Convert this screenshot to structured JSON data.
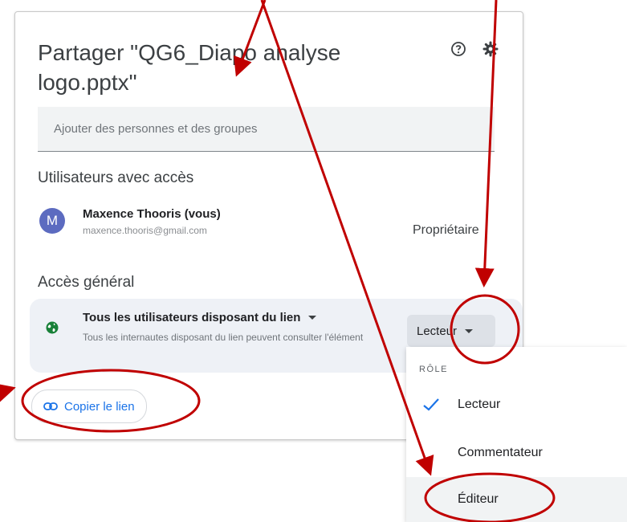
{
  "dialog": {
    "title": "Partager \"QG6_Diapo analyse logo.pptx\"",
    "help_icon": "help-circle-icon",
    "settings_icon": "gear-icon"
  },
  "add_people": {
    "placeholder": "Ajouter des personnes et des groupes"
  },
  "users_section": {
    "title": "Utilisateurs avec accès",
    "users": [
      {
        "initial": "M",
        "name": "Maxence Thooris (vous)",
        "email": "maxence.thooris@gmail.com",
        "role": "Propriétaire"
      }
    ]
  },
  "general_access": {
    "title": "Accès général",
    "type_label": "Tous les utilisateurs disposant du lien",
    "description": "Tous les internautes disposant du lien peuvent consulter l'élément",
    "role_label": "Lecteur",
    "icon": "globe-icon"
  },
  "copy_link": {
    "label": "Copier le lien",
    "icon": "link-icon"
  },
  "role_menu": {
    "header": "RÔLE",
    "items": [
      {
        "label": "Lecteur",
        "selected": true
      },
      {
        "label": "Commentateur",
        "selected": false
      },
      {
        "label": "Éditeur",
        "selected": false
      }
    ]
  },
  "colors": {
    "accent": "#1a73e8",
    "annotation": "#c00000",
    "avatar": "#5c6bc0",
    "globe": "#188038"
  }
}
